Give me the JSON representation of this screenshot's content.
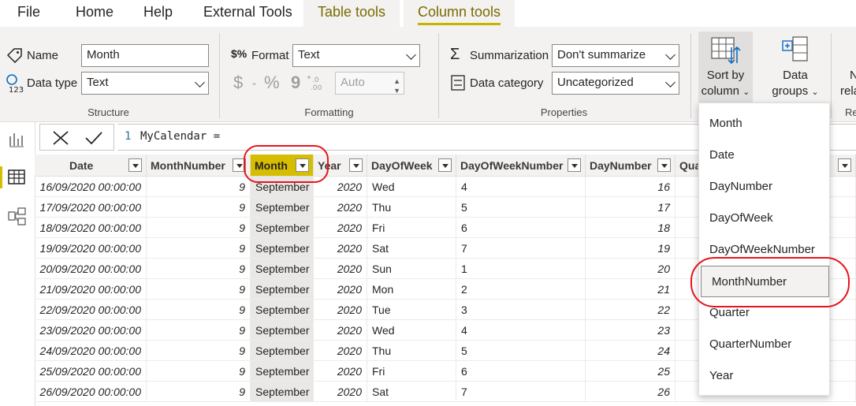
{
  "tabs": [
    {
      "label": "File"
    },
    {
      "label": "Home"
    },
    {
      "label": "Help"
    },
    {
      "label": "External Tools"
    },
    {
      "label": "Table tools"
    },
    {
      "label": "Column tools"
    }
  ],
  "structure": {
    "name_label": "Name",
    "name_value": "Month",
    "datatype_label": "Data type",
    "datatype_value": "Text",
    "group_title": "Structure"
  },
  "formatting": {
    "format_label": "Format",
    "format_value": "Text",
    "currency_symbol": "$",
    "percent_symbol": "%",
    "comma_symbol": "9",
    "decimals_value": "Auto",
    "group_title": "Formatting"
  },
  "properties": {
    "summarization_label": "Summarization",
    "summarization_value": "Don't summarize",
    "category_label": "Data category",
    "category_value": "Uncategorized",
    "group_title": "Properties"
  },
  "sort": {
    "line1": "Sort by",
    "line2": "column"
  },
  "groups": {
    "line1": "Data",
    "line2": "groups"
  },
  "partial": {
    "line1": "N",
    "line2": "rela",
    "title": "Re"
  },
  "formula": {
    "line_num": "1",
    "code": "MyCalendar ="
  },
  "columns": [
    "Date",
    "MonthNumber",
    "Month",
    "Year",
    "DayOfWeek",
    "DayOfWeekNumber",
    "DayNumber",
    "Quarter"
  ],
  "rows": [
    [
      "16/09/2020 00:00:00",
      "9",
      "September",
      "2020",
      "Wed",
      "4",
      "16"
    ],
    [
      "17/09/2020 00:00:00",
      "9",
      "September",
      "2020",
      "Thu",
      "5",
      "17"
    ],
    [
      "18/09/2020 00:00:00",
      "9",
      "September",
      "2020",
      "Fri",
      "6",
      "18"
    ],
    [
      "19/09/2020 00:00:00",
      "9",
      "September",
      "2020",
      "Sat",
      "7",
      "19"
    ],
    [
      "20/09/2020 00:00:00",
      "9",
      "September",
      "2020",
      "Sun",
      "1",
      "20"
    ],
    [
      "21/09/2020 00:00:00",
      "9",
      "September",
      "2020",
      "Mon",
      "2",
      "21"
    ],
    [
      "22/09/2020 00:00:00",
      "9",
      "September",
      "2020",
      "Tue",
      "3",
      "22"
    ],
    [
      "23/09/2020 00:00:00",
      "9",
      "September",
      "2020",
      "Wed",
      "4",
      "23"
    ],
    [
      "24/09/2020 00:00:00",
      "9",
      "September",
      "2020",
      "Thu",
      "5",
      "24"
    ],
    [
      "25/09/2020 00:00:00",
      "9",
      "September",
      "2020",
      "Fri",
      "6",
      "25"
    ],
    [
      "26/09/2020 00:00:00",
      "9",
      "September",
      "2020",
      "Sat",
      "7",
      "26"
    ]
  ],
  "sort_menu": [
    "Month",
    "Date",
    "DayNumber",
    "DayOfWeek",
    "DayOfWeekNumber",
    "MonthNumber",
    "Quarter",
    "QuarterNumber",
    "Year"
  ],
  "highlighted_menu_item": "MonthNumber",
  "colors": {
    "accent": "#d6bd00",
    "annotation": "#e8141c",
    "ribbon": "#f3f2f1"
  }
}
